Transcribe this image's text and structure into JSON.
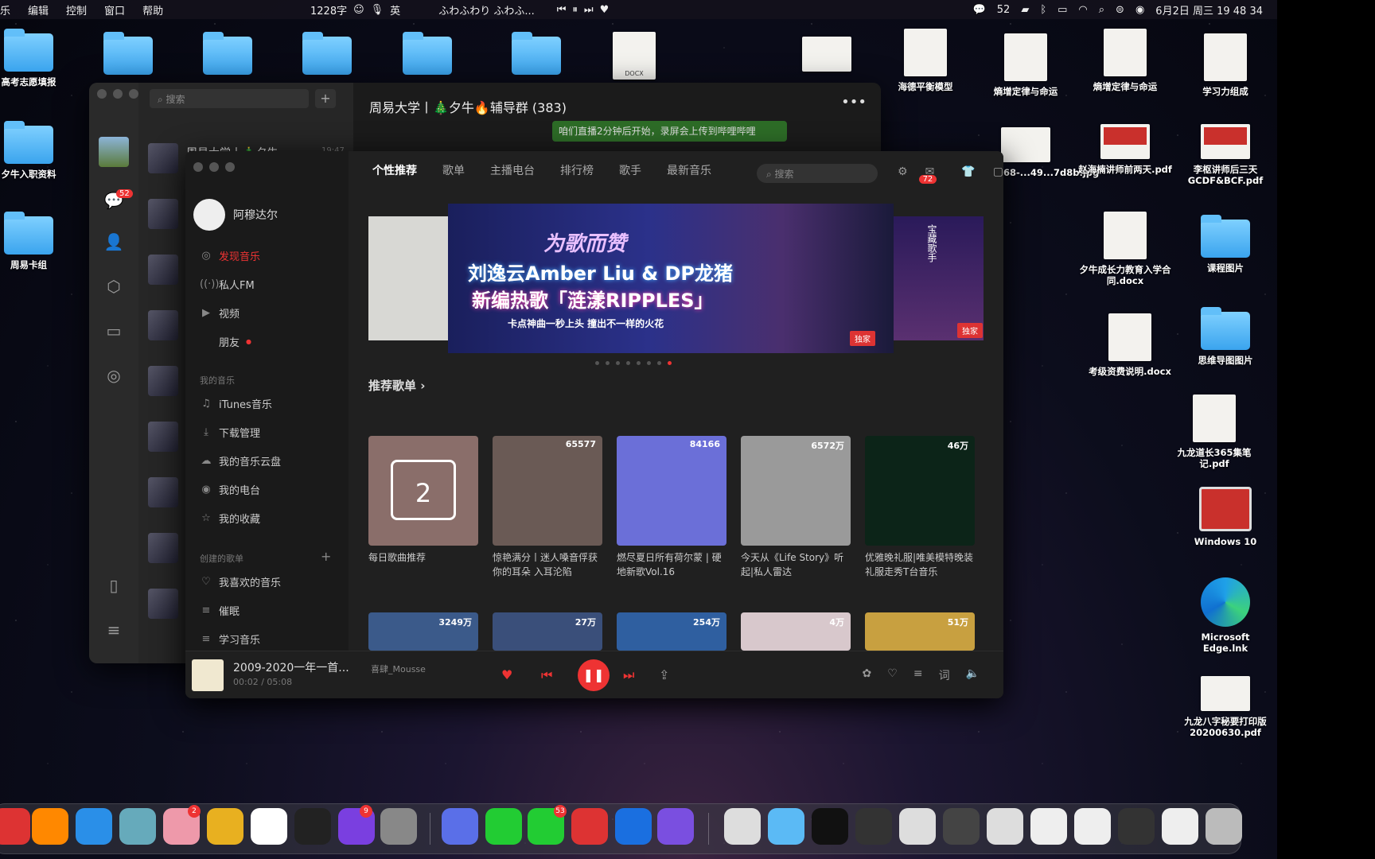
{
  "menubar": {
    "items": [
      "乐",
      "编辑",
      "控制",
      "窗口",
      "帮助"
    ],
    "count_text": "1228字",
    "ime": "英",
    "song": "ふわふわり ふわふ...",
    "wechat_count": "52",
    "datetime": "6月2日 周三 19 48 34"
  },
  "desktop": {
    "left_icons": [
      "高考志愿填报",
      "夕牛入职资料",
      "周易卡组"
    ],
    "right_icons": [
      {
        "label": "海德平衡模型",
        "kind": "doc"
      },
      {
        "label": "熵增定律与命运",
        "kind": "doc"
      },
      {
        "label": "熵增定律与命运",
        "kind": "doc"
      },
      {
        "label": "学习力组成",
        "kind": "doc"
      },
      {
        "label": "748668-...49...7d8b.jpg",
        "kind": "doc"
      },
      {
        "label": "赵海楠讲师前两天.pdf",
        "kind": "red"
      },
      {
        "label": "李枢讲师后三天GCDF&BCF.pdf",
        "kind": "red"
      },
      {
        "label": "夕牛成长力教育入学合同.docx",
        "kind": "doc"
      },
      {
        "label": "课程图片",
        "kind": "folder"
      },
      {
        "label": "考级资费说明.docx",
        "kind": "doc"
      },
      {
        "label": "思维导图图片",
        "kind": "folder"
      },
      {
        "label": "九龙道长365集笔记.pdf",
        "kind": "doc"
      },
      {
        "label": "Windows 10",
        "kind": "parallels"
      },
      {
        "label": "Microsoft Edge.lnk",
        "kind": "edge"
      },
      {
        "label": "九龙八字秘要打印版20200630.pdf",
        "kind": "doc"
      }
    ],
    "docx_label": "DOCX"
  },
  "wechat": {
    "title": "周易大学丨🎄夕牛🔥辅导群 (383)",
    "search_placeholder": "搜索",
    "first_chat": "周易大学丨🎄夕牛",
    "first_chat_time": "19:47",
    "unread": "52",
    "bubble_text": "咱们直播2分钟后开始，录屏会上传到哔哩哔哩"
  },
  "netease": {
    "user": "阿穆达尔",
    "tabs": [
      "个性推荐",
      "歌单",
      "主播电台",
      "排行榜",
      "歌手",
      "最新音乐"
    ],
    "search_placeholder": "搜索",
    "mail_badge": "72",
    "sidebar": {
      "top": [
        {
          "label": "发现音乐",
          "icon": "music-icon",
          "active": true
        },
        {
          "label": "私人FM",
          "icon": "radio-icon"
        },
        {
          "label": "视频",
          "icon": "video-icon"
        },
        {
          "label": "朋友",
          "icon": "friends-icon"
        }
      ],
      "my_music_head": "我的音乐",
      "my_music": [
        {
          "label": "iTunes音乐",
          "icon": "itunes-icon"
        },
        {
          "label": "下载管理",
          "icon": "download-icon"
        },
        {
          "label": "我的音乐云盘",
          "icon": "cloud-icon"
        },
        {
          "label": "我的电台",
          "icon": "podcast-icon"
        },
        {
          "label": "我的收藏",
          "icon": "star-icon"
        }
      ],
      "created_head": "创建的歌单",
      "playlists": [
        {
          "label": "我喜欢的音乐",
          "icon": "heart-icon"
        },
        {
          "label": "催眠",
          "icon": "playlist-icon"
        },
        {
          "label": "学习音乐",
          "icon": "playlist-icon"
        }
      ]
    },
    "banner": {
      "logo": "为歌而赞",
      "line1": "刘逸云Amber Liu & DP龙猪",
      "line2": "新编热歌「涟漾RIPPLES」",
      "line3": "卡点神曲一秒上头 撞出不一样的火花",
      "tag": "独家",
      "side_text": "宝藏歌手"
    },
    "section_title": "推荐歌单",
    "cards": [
      {
        "title": "每日歌曲推荐",
        "count": "",
        "bg": "#8a6e6a",
        "day": "2"
      },
      {
        "title": "惊艳满分丨迷人嗓音俘获你的耳朵 入耳沦陷",
        "count": "65577",
        "bg": "#6a5a55"
      },
      {
        "title": "燃尽夏日所有荷尔蒙 | 硬地新歌Vol.16",
        "count": "84166",
        "bg": "#6b6fd8"
      },
      {
        "title": "今天从《Life Story》听起|私人雷达",
        "count": "6572万",
        "bg": "#9a9a9a"
      },
      {
        "title": "优雅晚礼服|唯美模特晚装礼服走秀T台音乐",
        "count": "46万",
        "bg": "#0c2418"
      }
    ],
    "cards2": [
      {
        "count": "3249万",
        "bg": "#3b5a8a"
      },
      {
        "count": "27万",
        "bg": "#3a4f7a"
      },
      {
        "count": "254万",
        "bg": "#2f5fa0"
      },
      {
        "count": "4万",
        "bg": "#d8c8cc"
      },
      {
        "count": "51万",
        "bg": "#c8a040"
      }
    ],
    "player": {
      "title": "2009-2020一年一首...",
      "artist": "喜肆_Mousse",
      "time": "00:02 / 05:08"
    }
  },
  "dock": {
    "badges": [
      "2",
      "9",
      "53"
    ]
  },
  "colors": {
    "accent": "#e33b3b",
    "folder": "#5bbaf5"
  }
}
